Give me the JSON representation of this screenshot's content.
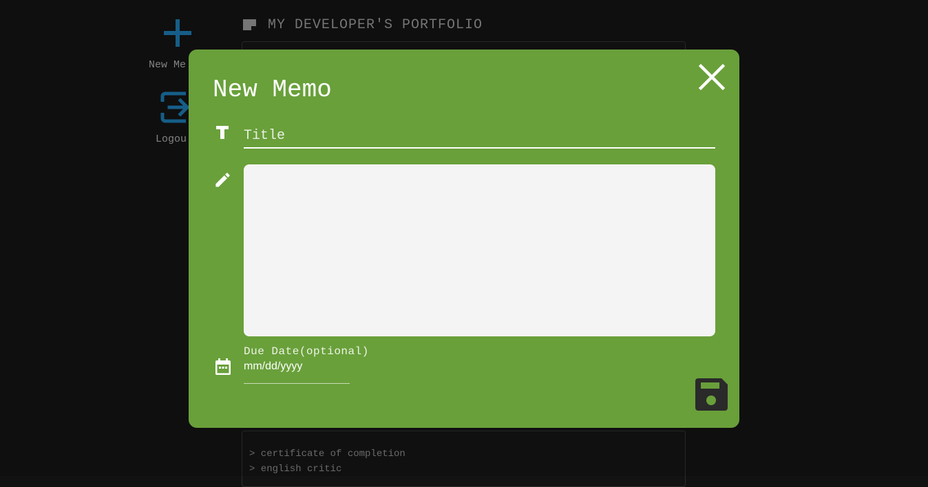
{
  "sidebar": {
    "new_memo_label": "New Me",
    "logout_label": "Logou"
  },
  "header": {
    "title": "MY DEVELOPER'S PORTFOLIO"
  },
  "memos": {
    "lines": [
      "> certificate of completion",
      "> english critic"
    ]
  },
  "modal": {
    "title": "New Memo",
    "title_placeholder": "Title",
    "body_value": "",
    "due_label": "Due Date(optional)",
    "date_placeholder": "mm/dd/yyyy"
  },
  "colors": {
    "background": "#121212",
    "modal": "#69a03a",
    "accent_blue": "#1b6fa0",
    "save_icon": "#2a2a2a"
  },
  "icons": {
    "new_memo": "plus-icon",
    "logout": "logout-icon",
    "header": "sticky-note-icon",
    "close": "close-icon",
    "title": "text-format-icon",
    "body": "pencil-icon",
    "date": "calendar-icon",
    "save": "floppy-disk-icon"
  }
}
